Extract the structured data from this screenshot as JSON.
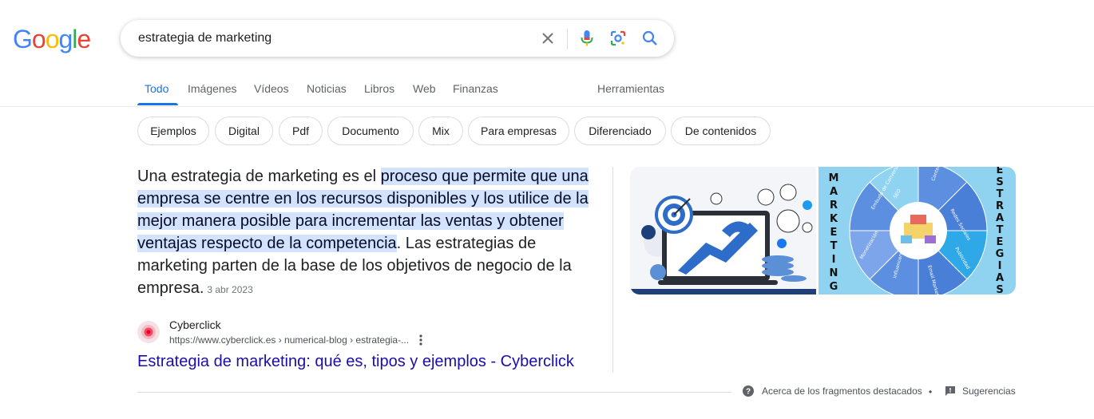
{
  "logo": {
    "letters": [
      "G",
      "o",
      "o",
      "g",
      "l",
      "e"
    ],
    "colors": [
      "#4285f4",
      "#ea4335",
      "#fbbc05",
      "#4285f4",
      "#34a853",
      "#ea4335"
    ]
  },
  "search": {
    "query": "estrategia de marketing"
  },
  "icons": {
    "clear": "close-icon",
    "voice": "microphone-icon",
    "lens": "google-lens-icon",
    "search": "search-icon"
  },
  "tabs": [
    "Todo",
    "Imágenes",
    "Vídeos",
    "Noticias",
    "Libros",
    "Web",
    "Finanzas"
  ],
  "active_tab": "Todo",
  "tools_label": "Herramientas",
  "chips": [
    "Ejemplos",
    "Digital",
    "Pdf",
    "Documento",
    "Mix",
    "Para empresas",
    "Diferenciado",
    "De contenidos"
  ],
  "snippet": {
    "prefix": "Una estrategia de marketing es el ",
    "highlight": "proceso que permite que una empresa se centre en los recursos disponibles y los utilice de la mejor manera posible para incrementar las ventas y obtener ventajas respecto de la competencia",
    "suffix": ". Las estrategias de marketing parten de la base de los objetivos de negocio de la empresa.",
    "date": "3 abr 2023"
  },
  "source": {
    "name": "Cyberclick",
    "url": "https://www.cyberclick.es › numerical-blog › estrategia-..."
  },
  "result_title": "Estrategia de marketing: qué es, tipos y ejemplos - Cyberclick",
  "image2": {
    "left_text": [
      "M",
      "A",
      "R",
      "K",
      "E",
      "T",
      "I",
      "N",
      "G"
    ],
    "right_text": [
      "E",
      "S",
      "T",
      "R",
      "A",
      "T",
      "E",
      "G",
      "I",
      "A",
      "S"
    ],
    "segments": [
      "SEO",
      "Contenidos",
      "Redes Sociales",
      "Publicidad",
      "Email Marketing",
      "Influencers",
      "Monetización",
      "Embudo de Conversión"
    ]
  },
  "footer": {
    "about": "Acerca de los fragmentos destacados",
    "separator": "•",
    "feedback": "Sugerencias"
  },
  "colors": {
    "link": "#1a0dab",
    "accent": "#1a73e8",
    "highlight": "#d3e3fd",
    "wheel": "#4a90d9",
    "image_bg": "#8fd3f0"
  }
}
